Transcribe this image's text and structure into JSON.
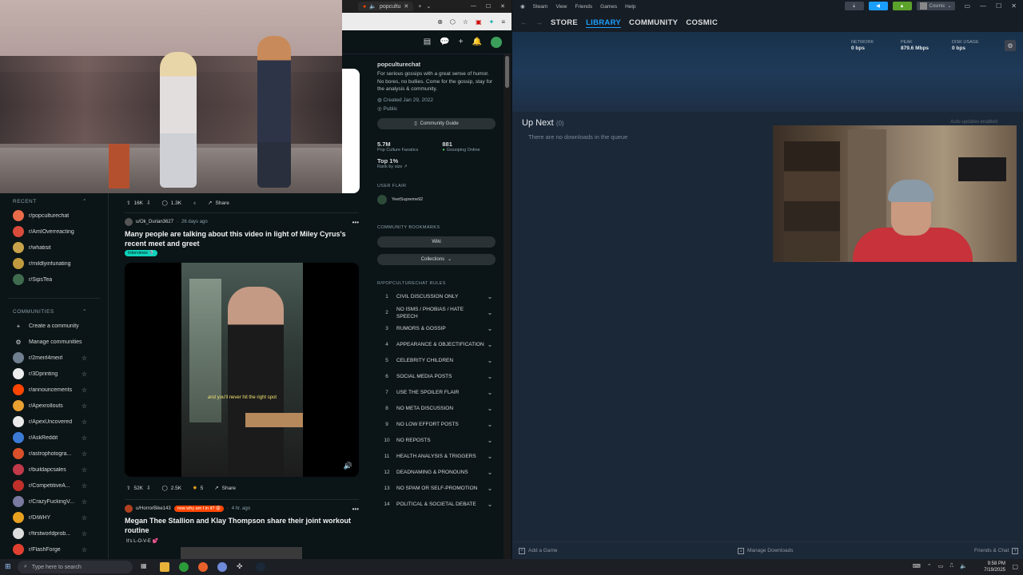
{
  "browser": {
    "tab_title": "popcultu",
    "header_icons": [
      "ad-icon",
      "chat-icon",
      "plus-icon",
      "bell-icon"
    ]
  },
  "left_sidebar": {
    "recent_heading": "RECENT",
    "recent": [
      {
        "label": "r/popculturechat",
        "color": "#e86b4a"
      },
      {
        "label": "r/AmIOverreacting",
        "color": "#d94b3b"
      },
      {
        "label": "r/whatisit",
        "color": "#c8a24a"
      },
      {
        "label": "r/mildlyinfuriating",
        "color": "#c09a3e"
      },
      {
        "label": "r/SipsTea",
        "color": "#3f6b4f"
      }
    ],
    "communities_heading": "COMMUNITIES",
    "create_label": "Create a community",
    "manage_label": "Manage communities",
    "communities": [
      {
        "label": "r/2meirl4meirl",
        "color": "#6f7f8f"
      },
      {
        "label": "r/3Dprinting",
        "color": "#ececec"
      },
      {
        "label": "r/announcements",
        "color": "#ff4500"
      },
      {
        "label": "r/Apexrollouts",
        "color": "#e8a030"
      },
      {
        "label": "r/ApexUncovered",
        "color": "#eaeaea"
      },
      {
        "label": "r/AskReddit",
        "color": "#3b7bd6"
      },
      {
        "label": "r/astrophotogra...",
        "color": "#d9502a"
      },
      {
        "label": "r/buildapcsales",
        "color": "#c03a4a"
      },
      {
        "label": "r/CompetitiveA...",
        "color": "#c0302a"
      },
      {
        "label": "r/CrazyFuckingV...",
        "color": "#7a7aa0"
      },
      {
        "label": "r/DiWHY",
        "color": "#e8a020"
      },
      {
        "label": "r/firstworldprob...",
        "color": "#dcdcdc"
      },
      {
        "label": "r/FlashForge",
        "color": "#e04030"
      }
    ]
  },
  "feed": {
    "top_actions": {
      "up": "16K",
      "comments": "1.3K",
      "share": "Share"
    },
    "post1": {
      "user": "u/Ok_Durian3627",
      "time": "26 days ago",
      "title": "Many people are talking about this video in light of Miley Cyrus's recent meet and greet",
      "flair": "Interviews 🎙️",
      "subtitle": "and you'll never hit the right spot",
      "actions": {
        "up": "52K",
        "comments": "2.5K",
        "awards": "5",
        "share": "Share"
      }
    },
    "post2": {
      "user": "u/HorrorBike143",
      "flair": "now why am I in it? 😩",
      "time": "4 hr. ago",
      "title": "Megan Thee Stallion and Klay Thompson share their joint workout routine",
      "body": "It's L-O-V-E 💕"
    }
  },
  "community": {
    "name": "popculturechat",
    "description": "For serious gossips with a great sense of humor. No bores, no bullies. Come for the gossip, stay for the analysis & community.",
    "created": "Created Jan 29, 2022",
    "visibility": "Public",
    "guide_label": "Community Guide",
    "members": "5.7M",
    "members_label": "Pop Culture Fanatics",
    "online": "881",
    "online_label": "Gossiping Online",
    "rank": "Top 1%",
    "rank_label": "Rank by size",
    "user_flair_heading": "USER FLAIR",
    "user_flair": "YeetSupreme92",
    "bookmarks_heading": "COMMUNITY BOOKMARKS",
    "wiki_label": "Wiki",
    "collections_label": "Collections",
    "rules_heading": "R/POPCULTURECHAT RULES",
    "rules": [
      "CIVIL DISCUSSION ONLY",
      "NO ISMS / PHOBIAS / HATE SPEECH",
      "RUMORS & GOSSIP",
      "APPEARANCE & OBJECTIFICATION",
      "CELEBRITY CHILDREN",
      "SOCIAL MEDIA POSTS",
      "USE THE SPOILER FLAIR",
      "NO META DISCUSSION",
      "NO LOW EFFORT POSTS",
      "NO REPOSTS",
      "HEALTH ANALYSIS & TRIGGERS",
      "DEADNAMING & PRONOUNS",
      "NO SPAM OR SELF-PROMOTION",
      "POLITICAL & SOCIETAL DEBATE"
    ]
  },
  "steam": {
    "menu": [
      "Steam",
      "View",
      "Friends",
      "Games",
      "Help"
    ],
    "nav": {
      "store": "STORE",
      "library": "LIBRARY",
      "community": "COMMUNITY",
      "user": "COSMIC"
    },
    "user_name": "Cosmic",
    "stats": {
      "network_label": "NETWORK",
      "network": "0 bps",
      "peak_label": "PEAK",
      "peak": "879.6 Mbps",
      "disk_label": "DISK USAGE",
      "disk": "0 bps"
    },
    "up_next": "Up Next",
    "up_next_count": "(0)",
    "empty": "There are no downloads in the queue",
    "auto_updates": "Auto-updates enabled",
    "footer": {
      "add_game": "Add a Game",
      "manage": "Manage Downloads",
      "friends": "Friends & Chat"
    }
  },
  "taskbar": {
    "search_placeholder": "Type here to search",
    "time": "9:58 PM",
    "date": "7/19/2025"
  }
}
